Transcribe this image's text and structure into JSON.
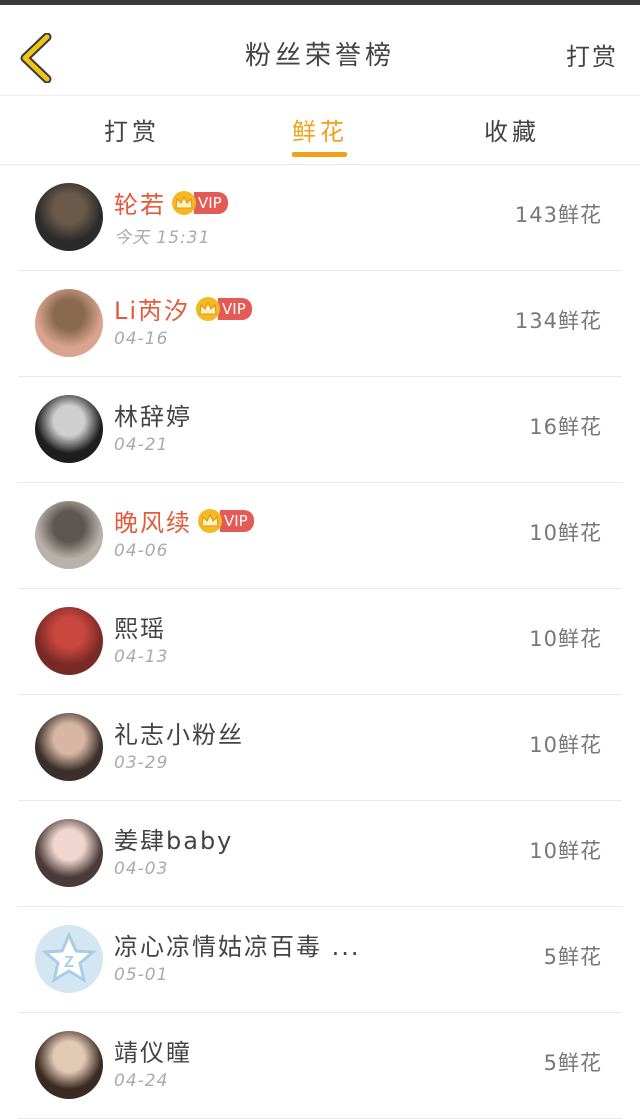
{
  "header": {
    "title": "粉丝荣誉榜",
    "action_label": "打赏",
    "back_icon": "chevron-left-icon",
    "accent_color": "#f0c419"
  },
  "tabs": [
    {
      "label": "打赏",
      "active": false
    },
    {
      "label": "鲜花",
      "active": true
    },
    {
      "label": "收藏",
      "active": false
    }
  ],
  "colors": {
    "accent": "#f0a01a",
    "vip_name": "#e4593a",
    "vip_badge": "#e45a55",
    "crown": "#f5b921"
  },
  "fans": [
    {
      "name": "轮若",
      "vip": true,
      "vip_label": "VIP",
      "date": "今天 15:31",
      "count": "143鲜花",
      "avatar": [
        "#2b2b2b",
        "#6b5a4a"
      ]
    },
    {
      "name": "Li芮汐",
      "vip": true,
      "vip_label": "VIP",
      "date": "04-16",
      "count": "134鲜花",
      "avatar": [
        "#d9a38f",
        "#8a6a4e"
      ]
    },
    {
      "name": "林辞婷",
      "vip": false,
      "vip_label": "",
      "date": "04-21",
      "count": "16鲜花",
      "avatar": [
        "#1e1e1e",
        "#cfcfcf"
      ]
    },
    {
      "name": "晚风续",
      "vip": true,
      "vip_label": "VIP",
      "date": "04-06",
      "count": "10鲜花",
      "avatar": [
        "#b9b2aa",
        "#5e5650"
      ]
    },
    {
      "name": "熙瑶",
      "vip": false,
      "vip_label": "",
      "date": "04-13",
      "count": "10鲜花",
      "avatar": [
        "#7a2a26",
        "#c9473e"
      ]
    },
    {
      "name": "礼志小粉丝",
      "vip": false,
      "vip_label": "",
      "date": "03-29",
      "count": "10鲜花",
      "avatar": [
        "#3a2f2b",
        "#d7b7a3"
      ]
    },
    {
      "name": "姜肆baby",
      "vip": false,
      "vip_label": "",
      "date": "04-03",
      "count": "10鲜花",
      "avatar": [
        "#4a3b38",
        "#f0d6cf"
      ]
    },
    {
      "name": "凉心凉情姑凉百毒 ...",
      "vip": false,
      "vip_label": "",
      "date": "05-01",
      "count": "5鲜花",
      "avatar": [
        "#d4e6f2",
        "#a9cde6"
      ],
      "default_avatar": true
    },
    {
      "name": "靖仪瞳",
      "vip": false,
      "vip_label": "",
      "date": "04-24",
      "count": "5鲜花",
      "avatar": [
        "#3b2a22",
        "#e2c9b4"
      ]
    }
  ]
}
